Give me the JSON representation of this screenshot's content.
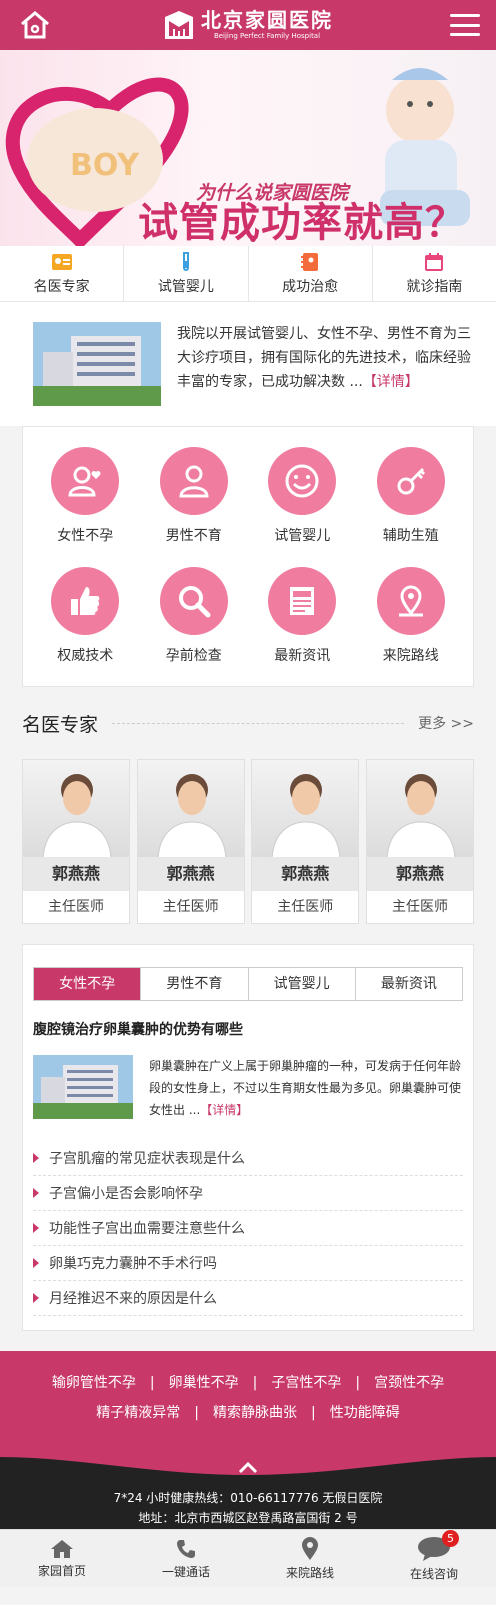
{
  "header": {
    "title_cn": "北京家圆医院",
    "title_en": "Beijing Perfect Family Hospital"
  },
  "banner": {
    "question": "为什么说家圆医院",
    "headline": "试管成功率就高？ ！",
    "boy_letters": "BOY"
  },
  "quicknav": [
    {
      "label": "名医专家",
      "icon": "doctor-card-icon"
    },
    {
      "label": "试管婴儿",
      "icon": "test-tube-icon"
    },
    {
      "label": "成功治愈",
      "icon": "notebook-icon"
    },
    {
      "label": "就诊指南",
      "icon": "calendar-icon"
    }
  ],
  "intro": {
    "text": "我院以开展试管婴儿、女性不孕、男性不育为三大诊疗项目，拥有国际化的先进技术，临床经验丰富的专家，已成功解决数 ...",
    "more": "【详情】"
  },
  "services": [
    {
      "label": "女性不孕",
      "icon": "female-heart-icon"
    },
    {
      "label": "男性不育",
      "icon": "male-user-icon"
    },
    {
      "label": "试管婴儿",
      "icon": "smile-icon"
    },
    {
      "label": "辅助生殖",
      "icon": "key-icon"
    },
    {
      "label": "权威技术",
      "icon": "thumbs-up-icon"
    },
    {
      "label": "孕前检查",
      "icon": "magnifier-icon"
    },
    {
      "label": "最新资讯",
      "icon": "news-icon"
    },
    {
      "label": "来院路线",
      "icon": "location-pin-icon"
    }
  ],
  "experts": {
    "title": "名医专家",
    "more": "更多 >>",
    "doctors": [
      {
        "name": "郭燕燕",
        "title": "主任医师"
      },
      {
        "name": "郭燕燕",
        "title": "主任医师"
      },
      {
        "name": "郭燕燕",
        "title": "主任医师"
      },
      {
        "name": "郭燕燕",
        "title": "主任医师"
      }
    ]
  },
  "news": {
    "tabs": [
      "女性不孕",
      "男性不育",
      "试管婴儿",
      "最新资讯"
    ],
    "active_tab": 0,
    "headline": "腹腔镜治疗卵巢囊肿的优势有哪些",
    "summary": "卵巢囊肿在广义上属于卵巢肿瘤的一种，可发病于任何年龄段的女性身上，不过以生育期女性最为多见。卵巢囊肿可使女性出 ...",
    "more": "【详情】",
    "items": [
      "子宫肌瘤的常见症状表现是什么",
      "子宫偏小是否会影响怀孕",
      "功能性子宫出血需要注意些什么",
      "卵巢巧克力囊肿不手术行吗",
      "月经推迟不来的原因是什么"
    ]
  },
  "footer_links": {
    "row1": [
      "输卵管性不孕",
      "卵巢性不孕",
      "子宫性不孕",
      "宫颈性不孕"
    ],
    "row2": [
      "精子精液异常",
      "精索静脉曲张",
      "性功能障碍"
    ],
    "separator": "|"
  },
  "footer_info": {
    "hotline": "7*24 小时健康热线：010-66117776  无假日医院",
    "address": "地址：北京市西城区赵登禹路富国街 2 号"
  },
  "tabbar": [
    {
      "label": "家园首页",
      "icon": "home-icon"
    },
    {
      "label": "一键通话",
      "icon": "phone-icon"
    },
    {
      "label": "来院路线",
      "icon": "map-pin-icon"
    },
    {
      "label": "在线咨询",
      "icon": "chat-bubble-icon",
      "badge": "5"
    }
  ],
  "colors": {
    "brand": "#c8396a",
    "service_circle": "#f07c9f",
    "dark": "#222222"
  }
}
